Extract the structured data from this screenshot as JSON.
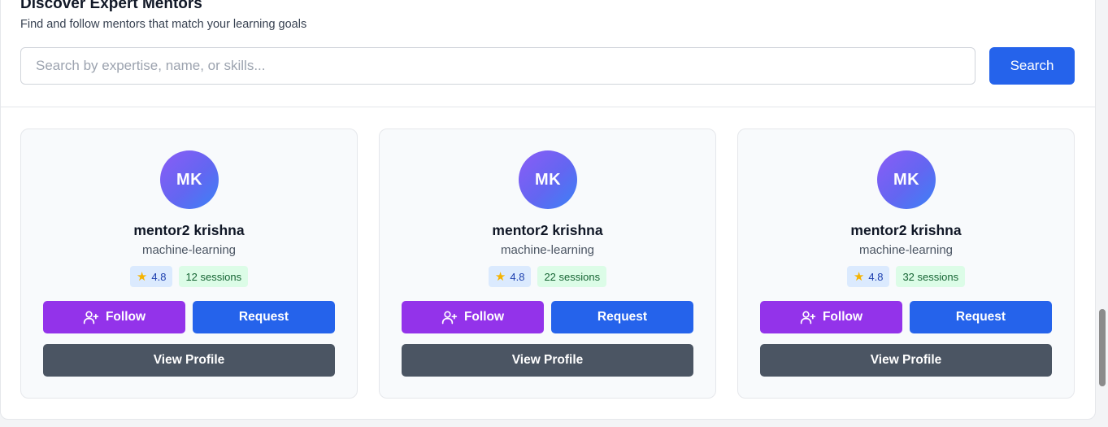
{
  "header": {
    "title": "Discover Expert Mentors",
    "subtitle": "Find and follow mentors that match your learning goals"
  },
  "search": {
    "placeholder": "Search by expertise, name, or skills...",
    "value": "",
    "button_label": "Search"
  },
  "mentors": [
    {
      "initials": "MK",
      "name": "mentor2 krishna",
      "expertise": "machine-learning",
      "rating": "4.8",
      "sessions": "12 sessions",
      "follow_label": "Follow",
      "request_label": "Request",
      "profile_label": "View Profile"
    },
    {
      "initials": "MK",
      "name": "mentor2 krishna",
      "expertise": "machine-learning",
      "rating": "4.8",
      "sessions": "22 sessions",
      "follow_label": "Follow",
      "request_label": "Request",
      "profile_label": "View Profile"
    },
    {
      "initials": "MK",
      "name": "mentor2 krishna",
      "expertise": "machine-learning",
      "rating": "4.8",
      "sessions": "32 sessions",
      "follow_label": "Follow",
      "request_label": "Request",
      "profile_label": "View Profile"
    }
  ],
  "icons": {
    "rating": "star-icon",
    "follow": "user-plus-icon"
  },
  "colors": {
    "primary": "#2563eb",
    "follow": "#9333ea",
    "profile": "#4b5563",
    "rating_badge_bg": "#dbeafe",
    "sessions_badge_bg": "#dcfce7"
  },
  "scroll": {
    "position_fraction": 0.82
  }
}
